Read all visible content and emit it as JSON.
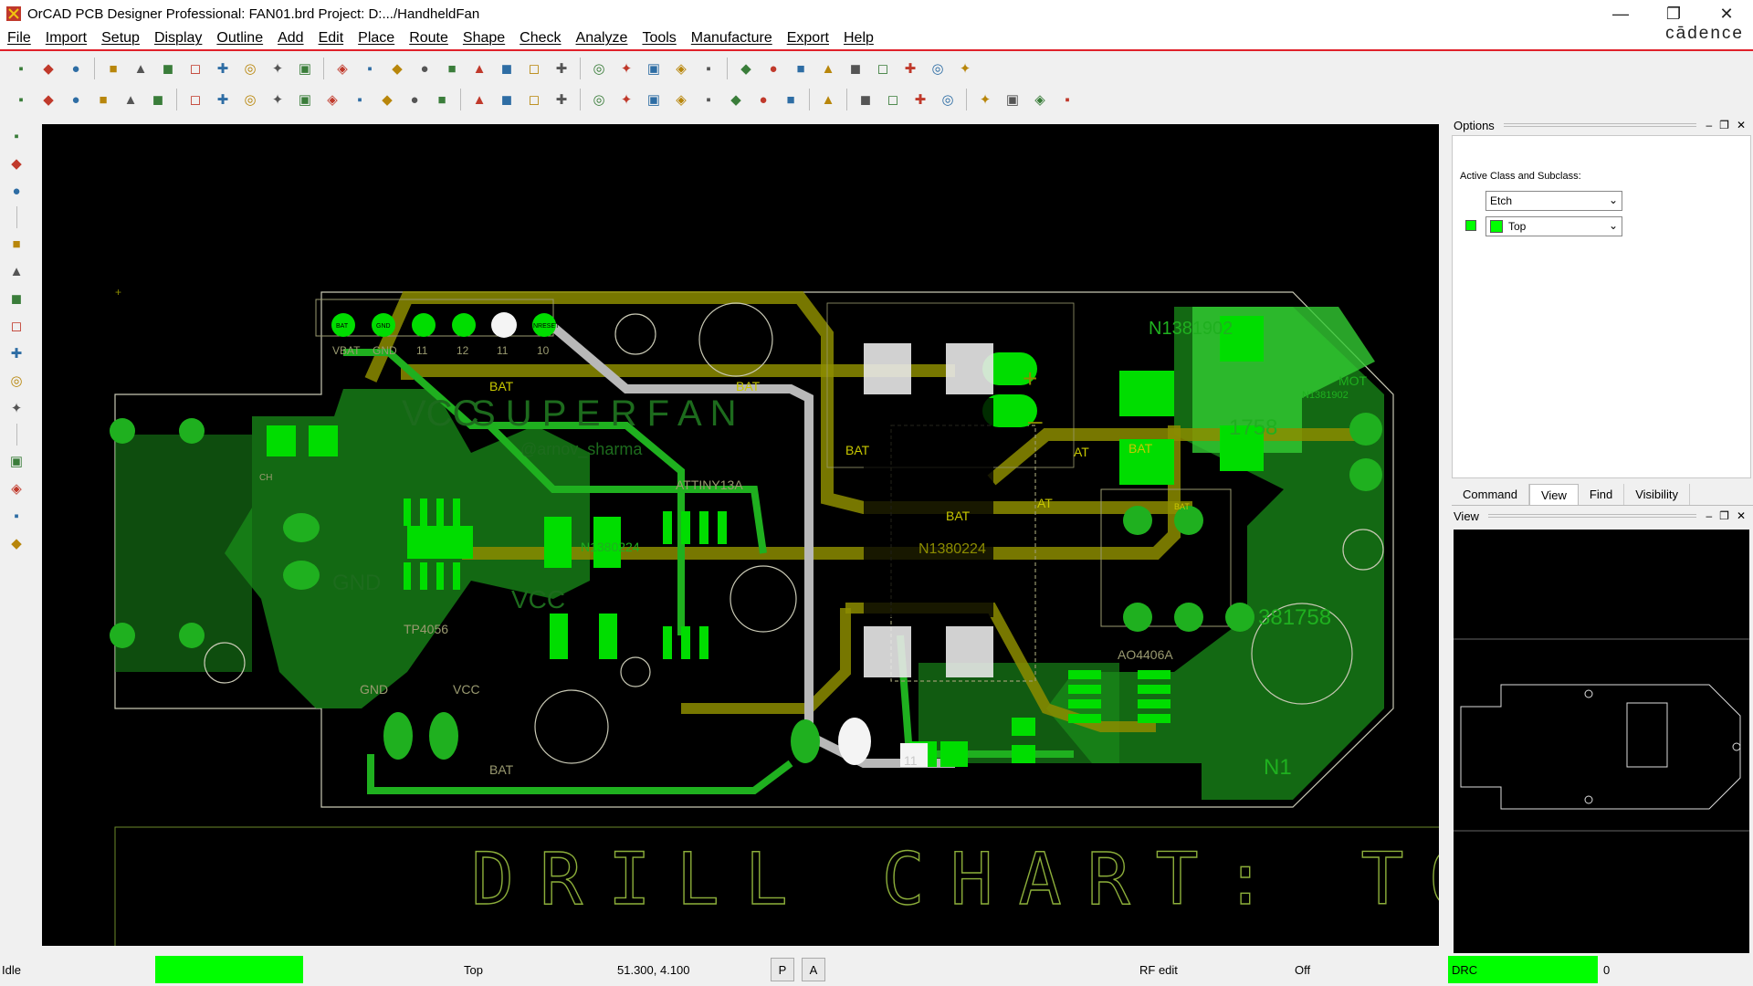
{
  "window": {
    "title": "OrCAD PCB Designer Professional: FAN01.brd  Project: D:.../HandheldFan",
    "brand": "cādence"
  },
  "menu": [
    "File",
    "Import",
    "Setup",
    "Display",
    "Outline",
    "Add",
    "Edit",
    "Place",
    "Route",
    "Shape",
    "Check",
    "Analyze",
    "Tools",
    "Manufacture",
    "Export",
    "Help"
  ],
  "board": {
    "silk_labels": {
      "vcc_big": "VCC",
      "name_big": "S U P E R  F A N",
      "author": "@arnov_sharma",
      "attiny": "ATTINY13A",
      "tp4056": "TP4056",
      "gnd_big": "GND",
      "vcc_mid": "VCC",
      "gnd_small": "GND",
      "vcc_small": "VCC",
      "bat_small": "BAT",
      "ch": "CH",
      "n1381902": "N1381902",
      "n1381902_small": "N1381902",
      "mot": "MOT",
      "n1381758_a": "1758",
      "n1381758_b": "381758",
      "n1_short": "N1",
      "ao4406a": "AO4406A",
      "n1380224_a": "N1380224",
      "n1380224_b": "N1380224",
      "plus": "+",
      "minus": "–"
    },
    "header_pins": [
      "VBAT",
      "GND",
      "11",
      "12",
      "11",
      "10"
    ],
    "header_pads": [
      "BAT",
      "GND",
      "",
      "",
      "",
      "NRESET"
    ],
    "net_labels": [
      "BAT",
      "BAT",
      "BAT",
      "BAT",
      "BAT",
      "BAT",
      "11",
      "AT",
      "AT"
    ],
    "drill_chart": "DRILL CHART: TOP"
  },
  "options": {
    "title": "Options",
    "active_class_label": "Active Class and Subclass:",
    "class_value": "Etch",
    "subclass_value": "Top",
    "subclass_color": "#00ff00"
  },
  "tabs": [
    "Command",
    "View",
    "Find",
    "Visibility"
  ],
  "view_panel": {
    "title": "View"
  },
  "status": {
    "state": "Idle",
    "layer": "Top",
    "coords": "51.300, 4.100",
    "p_btn": "P",
    "a_btn": "A",
    "mode": "RF edit",
    "off": "Off",
    "drc": "DRC",
    "drc_count": "0"
  },
  "colors": {
    "etch_top": "#00ff00",
    "etch_dim": "#1a8c1a",
    "yellow_trace": "#8c8c00",
    "gray_trace": "#b8b8b8",
    "outline": "#c8c8b4",
    "drill_text": "#8cae3a"
  },
  "icons": {
    "toolbar1": [
      "new-icon",
      "open-icon",
      "save-icon",
      "move-icon",
      "copy-icon",
      "delete-icon",
      "undo-icon",
      "redo-icon",
      "dropdown-icon",
      "add-connect-icon",
      "pin-icon",
      "grid-icon",
      "zoom-fit-icon",
      "zoom-in-icon",
      "zoom-out-icon",
      "zoom-world-icon",
      "zoom-prev-icon",
      "refresh-icon",
      "3d-icon",
      "flip-icon",
      "grid2-icon",
      "layers-icon",
      "color-icon",
      "shape-icon",
      "drc-icon",
      "info-icon",
      "properties-icon",
      "number-icon",
      "brush-icon",
      "sun-icon",
      "sun2-icon",
      "bars-icon",
      "xwin-icon",
      "highlight-icon"
    ],
    "toolbar2": [
      "etch-icon",
      "etch2-icon",
      "etch3-icon",
      "etch4-icon",
      "etch5-icon",
      "etch6-icon",
      "line-icon",
      "rect-icon",
      "circle-icon",
      "select-icon",
      "frame-icon",
      "arc-icon",
      "rect2-icon",
      "circle2-icon",
      "fill-icon",
      "stack-icon",
      "place-icon",
      "dim-icon",
      "dim2-icon",
      "tool-icon",
      "book-icon",
      "measure-icon",
      "camera-icon",
      "text-icon",
      "grid3-icon",
      "check-icon",
      "grid4-icon",
      "grid5-icon",
      "wave-icon",
      "doc-icon",
      "doc2-icon",
      "doc3-icon",
      "doc4-icon",
      "copy2-icon",
      "mail-icon",
      "mail2-icon",
      "help-icon"
    ],
    "left": [
      "manufacture-icon",
      "component-icon",
      "symbol-icon",
      "route-icon",
      "fanout-icon",
      "diffpair-icon",
      "slide-icon",
      "spread-icon",
      "tune-icon",
      "phase-icon",
      "line-draw-icon",
      "rect-draw-icon",
      "text-add-icon",
      "text-edit-icon"
    ]
  }
}
